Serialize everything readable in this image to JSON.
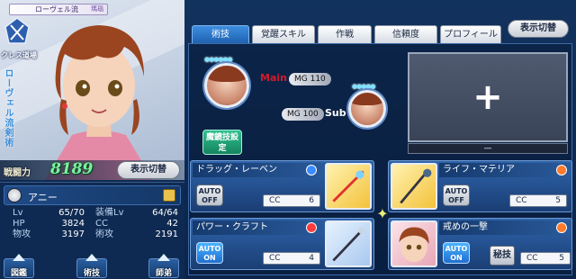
{
  "portrait": {
    "class_banner": "ローヴェル流",
    "class_badge": "瑪瑙",
    "class_label": "クレス道場",
    "vertical_name": "ローヴェル流剣術",
    "power_label": "戦闘力",
    "power_value": "8189",
    "toggle_label": "表示切替"
  },
  "status": {
    "name": "アニー",
    "rows": [
      {
        "l1": "Lv",
        "v1": "65/70",
        "l2": "装備Lv",
        "v2": "64/64"
      },
      {
        "l1": "HP",
        "v1": "3824",
        "l2": "CC",
        "v2": "42"
      },
      {
        "l1": "物攻",
        "v1": "3197",
        "l2": "術攻",
        "v2": "2191"
      }
    ],
    "nav": [
      {
        "label": "図鑑"
      },
      {
        "label": "術技"
      },
      {
        "label": "師弟"
      }
    ]
  },
  "tabs": [
    {
      "label": "術技"
    },
    {
      "label": "覚醒スキル"
    },
    {
      "label": "作戦"
    },
    {
      "label": "信頼度"
    },
    {
      "label": "プロフィール"
    }
  ],
  "header_toggle": "表示切替",
  "mystic": {
    "main_word": "Main",
    "main_mg": "MG 110",
    "sub_word": "Sub",
    "sub_mg": "MG 100",
    "dots_main": "●●●●●●",
    "dots_sub": "●●●●●",
    "button_label": "魔鏡技設定"
  },
  "add_box": {
    "plus": "+",
    "bar": "—"
  },
  "artes": [
    {
      "name": "ドラッグ・レーベン",
      "auto": "AUTO OFF",
      "cc_label": "CC",
      "cc": "6",
      "elem_color": "#3a8bff"
    },
    {
      "name": "ライフ・マテリア",
      "auto": "AUTO OFF",
      "cc_label": "CC",
      "cc": "5",
      "elem_color": "#ff7a2a"
    },
    {
      "name": "パワー・クラフト",
      "auto": "AUTO ON",
      "cc_label": "CC",
      "cc": "4",
      "elem_color": "#ff3b3b"
    },
    {
      "name": "戒めの一撃",
      "auto": "AUTO ON",
      "cc_label": "CC",
      "cc": "5",
      "elem_color": "#ff7a2a",
      "hiougi": "秘技"
    }
  ],
  "colors": {
    "accent_blue": "#1f62b0",
    "power_green": "#7ef0a0",
    "main_red": "#d21a2a"
  }
}
